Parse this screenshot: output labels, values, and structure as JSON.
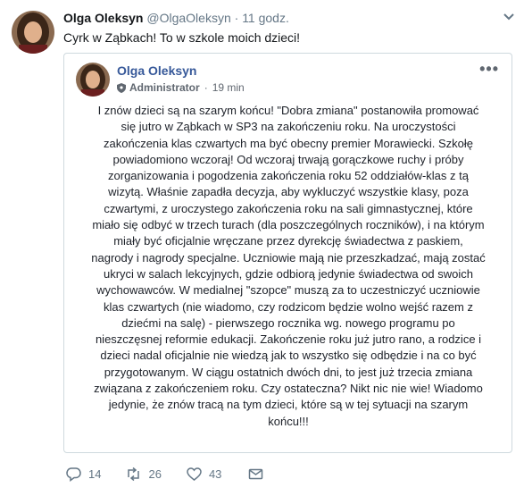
{
  "tweet": {
    "author_name": "Olga Oleksyn",
    "handle": "@OlgaOleksyn",
    "separator": "·",
    "time": "11 godz.",
    "text": "Cyrk w Ząbkach! To w szkole moich dzieci!",
    "avatar_icon": "avatar-photo",
    "menu_icon": "chevron-down-icon"
  },
  "embedded_post": {
    "author_name": "Olga Oleksyn",
    "role": "Administrator",
    "separator": "·",
    "time": "19 min",
    "more_label": "•••",
    "body": "I znów dzieci są na szarym końcu! \"Dobra zmiana\" postanowiła promować\nsię jutro w Ząbkach w SP3 na zakończeniu roku. Na uroczystości\nzakończenia klas czwartych ma być obecny premier Morawiecki. Szkołę\npowiadomiono wczoraj! Od wczoraj trwają gorączkowe ruchy i próby\nzorganizowania i pogodzenia zakończenia roku 52 oddziałów-klas z tą\nwizytą. Właśnie zapadła decyzja, aby wykluczyć wszystkie klasy, poza\nczwartymi, z uroczystego zakończenia roku na sali gimnastycznej, które\nmiało się odbyć w trzech turach (dla poszczególnych roczników), i na którym\nmiały być oficjalnie wręczane przez dyrekcję świadectwa z paskiem,\nnagrody i nagrody specjalne. Uczniowie mają nie przeszkadzać, mają zostać\nukryci w salach lekcyjnych, gdzie odbiorą jedynie świadectwa od swoich\nwychowawców. W medialnej \"szopce\" muszą za to uczestniczyć uczniowie\nklas czwartych (nie wiadomo, czy rodzicom będzie wolno wejść razem z\ndziećmi na salę) - pierwszego rocznika wg. nowego programu po\nnieszczęsnej reformie edukacji. Zakończenie roku już jutro rano, a rodzice i\ndzieci nadal oficjalnie nie wiedzą jak to wszystko się odbędzie i na co być\nprzygotowanym. W ciągu ostatnich dwóch dni, to jest już trzecia zmiana\nzwiązana z zakończeniem roku. Czy ostateczna? Nikt nic nie wie! Wiadomo\njedynie, że znów tracą na tym dzieci, które są w tej sytuacji na szarym\nkońcu!!!"
  },
  "actions": {
    "reply_count": "14",
    "retweet_count": "26",
    "like_count": "43",
    "icons": [
      "reply-icon",
      "retweet-icon",
      "like-icon",
      "direct-message-icon"
    ]
  },
  "colors": {
    "text": "#14171a",
    "muted": "#657786",
    "fb_link": "#365899",
    "border": "#cfd9de"
  }
}
